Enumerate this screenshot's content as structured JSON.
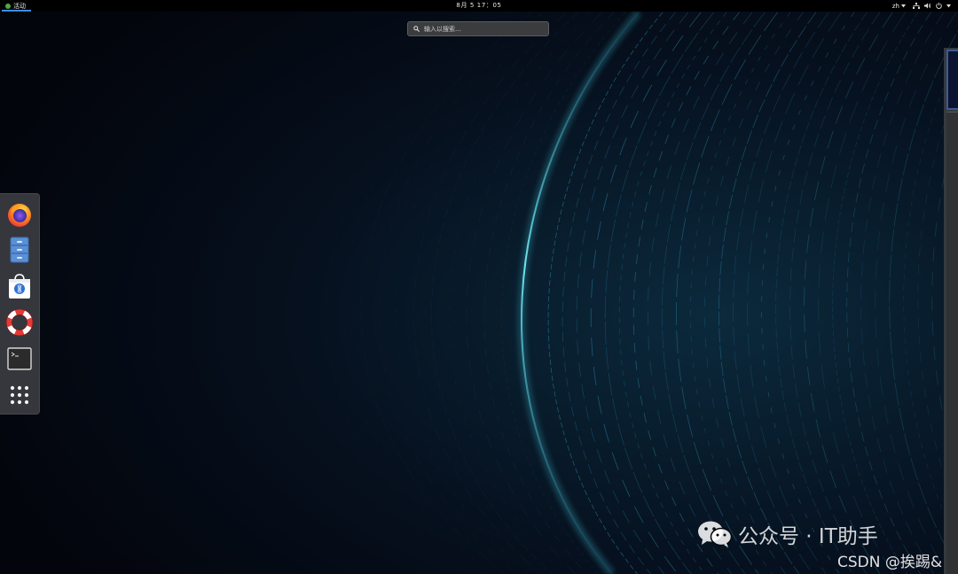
{
  "topbar": {
    "activities_label": "活动",
    "clock": "8月 5  17：05",
    "language": "zh",
    "icons": [
      "network-icon",
      "volume-icon",
      "power-icon"
    ]
  },
  "search": {
    "placeholder": "输入以搜索…"
  },
  "dash": {
    "apps": [
      {
        "name": "firefox-icon"
      },
      {
        "name": "files-icon"
      },
      {
        "name": "software-icon"
      },
      {
        "name": "help-icon"
      },
      {
        "name": "terminal-icon"
      },
      {
        "name": "show-apps-icon"
      }
    ]
  },
  "watermark": {
    "line1": "公众号 · IT助手",
    "line2": "CSDN @挨踢&"
  },
  "colors": {
    "topbar": "#000000",
    "accent": "#3c8ce7",
    "wallpaper_glow": "#3fc3d6"
  }
}
